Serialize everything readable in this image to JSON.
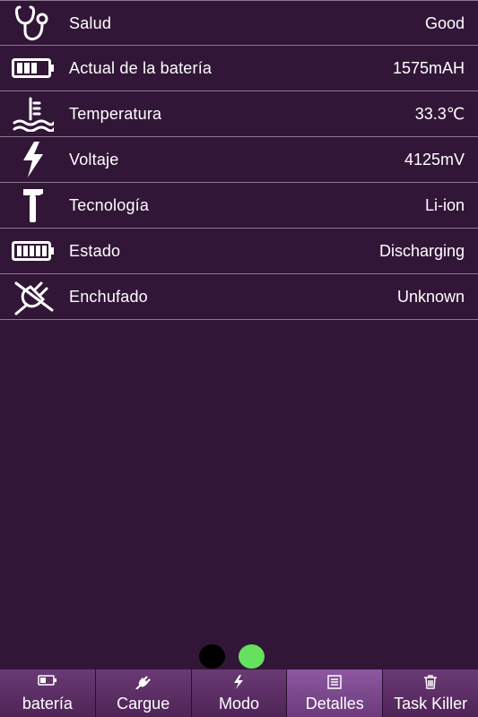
{
  "details": [
    {
      "icon": "stethoscope-icon",
      "label": "Salud",
      "value": "Good"
    },
    {
      "icon": "battery-level-icon",
      "label": "Actual de la batería",
      "value": "1575mAH"
    },
    {
      "icon": "thermometer-icon",
      "label": "Temperatura",
      "value": "33.3℃"
    },
    {
      "icon": "lightning-bolt-icon",
      "label": "Voltaje",
      "value": "4125mV"
    },
    {
      "icon": "hammer-icon",
      "label": "Tecnología",
      "value": "Li-ion"
    },
    {
      "icon": "battery-full-icon",
      "label": "Estado",
      "value": "Discharging"
    },
    {
      "icon": "unplugged-icon",
      "label": "Enchufado",
      "value": "Unknown"
    }
  ],
  "pager": {
    "page_count": 2,
    "current_page": 2,
    "active_color": "#65e05f",
    "inactive_color": "#000000"
  },
  "tabs": [
    {
      "icon": "battery-icon",
      "label": "batería"
    },
    {
      "icon": "plug-icon",
      "label": "Cargue"
    },
    {
      "icon": "bolt-icon",
      "label": "Modo"
    },
    {
      "icon": "list-icon",
      "label": "Detalles",
      "active": true
    },
    {
      "icon": "trash-icon",
      "label": "Task Killer"
    }
  ],
  "colors": {
    "background": "#321638",
    "tab_bar": "#5a2d63",
    "tab_active": "#8d58a0",
    "divider": "#8a7a8f"
  }
}
